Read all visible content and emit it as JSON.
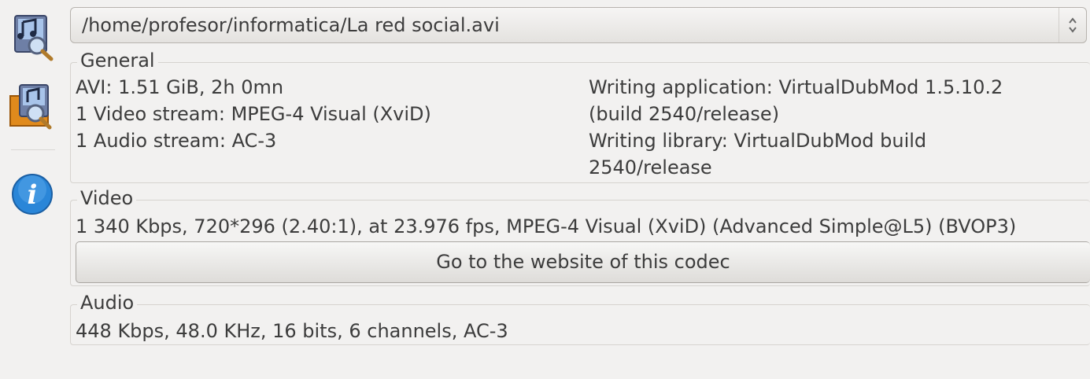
{
  "file_select": {
    "value": "/home/profesor/informatica/La red social.avi"
  },
  "toolbar": {
    "items": [
      {
        "icon": "media-info-icon"
      },
      {
        "icon": "folder-media-icon"
      },
      {
        "icon": "info-icon",
        "glyph": "i"
      }
    ]
  },
  "general": {
    "title": "General",
    "left_lines": [
      "AVI: 1.51 GiB, 2h 0mn",
      "1 Video stream: MPEG-4 Visual (XviD)",
      "1 Audio stream: AC-3"
    ],
    "right_lines": [
      "Writing application: VirtualDubMod 1.5.10.2",
      "(build 2540/release)",
      "Writing library: VirtualDubMod build",
      "2540/release"
    ]
  },
  "video": {
    "title": "Video",
    "line": "1 340 Kbps, 720*296 (2.40:1), at 23.976 fps, MPEG-4 Visual (XviD) (Advanced Simple@L5) (BVOP3)",
    "codec_button": "Go to the website of this codec"
  },
  "audio": {
    "title": "Audio",
    "line": "448 Kbps, 48.0 KHz, 16 bits, 6 channels, AC-3"
  },
  "colors": {
    "info_blue": "#2a86d8",
    "folder_orange": "#e08a1c"
  }
}
